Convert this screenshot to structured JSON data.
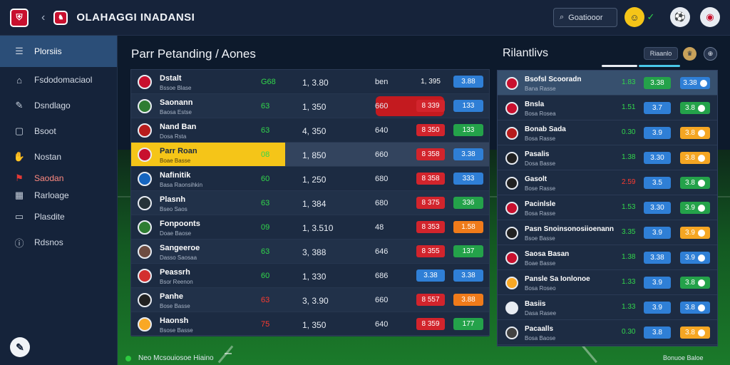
{
  "colors": {
    "accent": "#2b4e78",
    "highlight": "#f5c518",
    "positive": "#32d74b",
    "negative": "#ff3b30"
  },
  "header": {
    "title": "OLAHAGGI INADANSI",
    "back_icon": "chevron-left-icon",
    "search_label": "Goatiooor",
    "search_icon": "search-icon"
  },
  "sidebar": {
    "items": [
      {
        "label": "Plorsiis",
        "icon": "menu-icon"
      },
      {
        "label": "Fsdodomaciaol",
        "icon": "building-icon"
      },
      {
        "label": "Dsndlago",
        "icon": "pencil-icon"
      },
      {
        "label": "Bsoot",
        "icon": "square-icon"
      },
      {
        "label": "Nostan",
        "icon": "hand-icon"
      },
      {
        "label": "Saodan",
        "icon": "flag-icon"
      },
      {
        "label": "Rarloage",
        "icon": "grid-icon"
      },
      {
        "label": "Plasdite",
        "icon": "box-icon"
      },
      {
        "label": "Rdsnos",
        "icon": "info-icon"
      }
    ]
  },
  "main": {
    "title": "Parr Petanding / Aones",
    "rows": [
      {
        "name": "Dstalt",
        "sub": "Bssoe Blase",
        "c1": "G68",
        "c1c": "green",
        "c2": "1, 3.80",
        "c3": "ben",
        "p1": "1, 395",
        "p1c": "",
        "p2": "3.88",
        "p2c": "bg-blue"
      },
      {
        "name": "Saonann",
        "sub": "Baosa Estse",
        "c1": "63",
        "c1c": "green",
        "c2": "1, 350",
        "c3": "660",
        "p1": "8 339",
        "p1c": "bg-red",
        "p2": "133",
        "p2c": "bg-blue"
      },
      {
        "name": "Nand Ban",
        "sub": "Dosa Rsta",
        "c1": "63",
        "c1c": "green",
        "c2": "4, 350",
        "c3": "640",
        "p1": "8 350",
        "p1c": "bg-red",
        "p2": "133",
        "p2c": "bg-green"
      },
      {
        "name": "Parr Roan",
        "sub": "Boae Basse",
        "c1": "08",
        "c1c": "green",
        "c2": "1, 850",
        "c3": "660",
        "p1": "8 358",
        "p1c": "bg-red",
        "p2": "3.38",
        "p2c": "bg-blue"
      },
      {
        "name": "Nafinitik",
        "sub": "Basa Raonsihkin",
        "c1": "60",
        "c1c": "green",
        "c2": "1, 250",
        "c3": "680",
        "p1": "8 358",
        "p1c": "bg-red",
        "p2": "333",
        "p2c": "bg-blue"
      },
      {
        "name": "Plasnh",
        "sub": "Bseo Saos",
        "c1": "63",
        "c1c": "green",
        "c2": "1, 384",
        "c3": "680",
        "p1": "8 375",
        "p1c": "bg-red",
        "p2": "336",
        "p2c": "bg-green"
      },
      {
        "name": "Fonpoonts",
        "sub": "Doae Baose",
        "c1": "09",
        "c1c": "green",
        "c2": "1, 3.510",
        "c3": "48",
        "p1": "8 353",
        "p1c": "bg-red",
        "p2": "1.58",
        "p2c": "bg-orange"
      },
      {
        "name": "Sangeeroe",
        "sub": "Dasso Saosaa",
        "c1": "63",
        "c1c": "green",
        "c2": "3, 388",
        "c3": "646",
        "p1": "8 355",
        "p1c": "bg-red",
        "p2": "137",
        "p2c": "bg-green"
      },
      {
        "name": "Peassrh",
        "sub": "Bsor Reenon",
        "c1": "60",
        "c1c": "green",
        "c2": "1, 330",
        "c3": "686",
        "p1": "3.38",
        "p1c": "bg-blue",
        "p2": "3.38",
        "p2c": "bg-blue"
      },
      {
        "name": "Panhe",
        "sub": "Bose Basse",
        "c1": "63",
        "c1c": "red",
        "c2": "3, 3.90",
        "c3": "660",
        "p1": "8 557",
        "p1c": "bg-red",
        "p2": "3.88",
        "p2c": "bg-orange"
      },
      {
        "name": "Haonsh",
        "sub": "Bsose Basse",
        "c1": "75",
        "c1c": "red",
        "c2": "1, 350",
        "c3": "640",
        "p1": "8 359",
        "p1c": "bg-red",
        "p2": "177",
        "p2c": "bg-green"
      }
    ]
  },
  "right": {
    "title": "Rilantlivs",
    "buttons": [
      "Riaanlo"
    ],
    "rows": [
      {
        "name": "Bsofsl Scooradn",
        "sub": "Bana Rasse",
        "c1": "1.83",
        "c1c": "green",
        "p1": "3.38",
        "p1c": "bg-green",
        "p2": "3.38",
        "p2c": "bg-blue"
      },
      {
        "name": "Bnsla",
        "sub": "Bosa Rosea",
        "c1": "1.51",
        "c1c": "green",
        "p1": "3.7",
        "p1c": "bg-blue",
        "p2": "3.8",
        "p2c": "bg-green"
      },
      {
        "name": "Bonab Sada",
        "sub": "Bosa Rasse",
        "c1": "0.30",
        "c1c": "green",
        "p1": "3.9",
        "p1c": "bg-blue",
        "p2": "3.8",
        "p2c": "bg-yellow"
      },
      {
        "name": "Pasalis",
        "sub": "Dosa Basse",
        "c1": "1.38",
        "c1c": "green",
        "p1": "3.30",
        "p1c": "bg-blue",
        "p2": "3.8",
        "p2c": "bg-yellow"
      },
      {
        "name": "Gasolt",
        "sub": "Bose Rasse",
        "c1": "2.59",
        "c1c": "red",
        "p1": "3.5",
        "p1c": "bg-blue",
        "p2": "3.8",
        "p2c": "bg-green"
      },
      {
        "name": "Pacinlsle",
        "sub": "Bosa Rasse",
        "c1": "1.53",
        "c1c": "green",
        "p1": "3.30",
        "p1c": "bg-blue",
        "p2": "3.9",
        "p2c": "bg-green"
      },
      {
        "name": "Pasn Snoinsonosiioenann",
        "sub": "Bsoe Basse",
        "c1": "3.35",
        "c1c": "green",
        "p1": "3.9",
        "p1c": "bg-blue",
        "p2": "3.9",
        "p2c": "bg-yellow"
      },
      {
        "name": "Saosa Basan",
        "sub": "Boae Basse",
        "c1": "1.38",
        "c1c": "green",
        "p1": "3.38",
        "p1c": "bg-blue",
        "p2": "3.9",
        "p2c": "bg-blue"
      },
      {
        "name": "Pansle Sa Ionlonoe",
        "sub": "Bosa Roseo",
        "c1": "1.33",
        "c1c": "green",
        "p1": "3.9",
        "p1c": "bg-blue",
        "p2": "3.8",
        "p2c": "bg-green"
      },
      {
        "name": "Basiis",
        "sub": "Dasa Rasee",
        "c1": "1.33",
        "c1c": "green",
        "p1": "3.9",
        "p1c": "bg-blue",
        "p2": "3.8",
        "p2c": "bg-blue"
      },
      {
        "name": "Pacaalls",
        "sub": "Bosa Baose",
        "c1": "0.30",
        "c1c": "green",
        "p1": "3.8",
        "p1c": "bg-blue",
        "p2": "3.8",
        "p2c": "bg-yellow"
      }
    ]
  },
  "footer": {
    "status": "Neo Mcsouiosoe Hiaino",
    "right": "Bonuoe Baloe"
  }
}
